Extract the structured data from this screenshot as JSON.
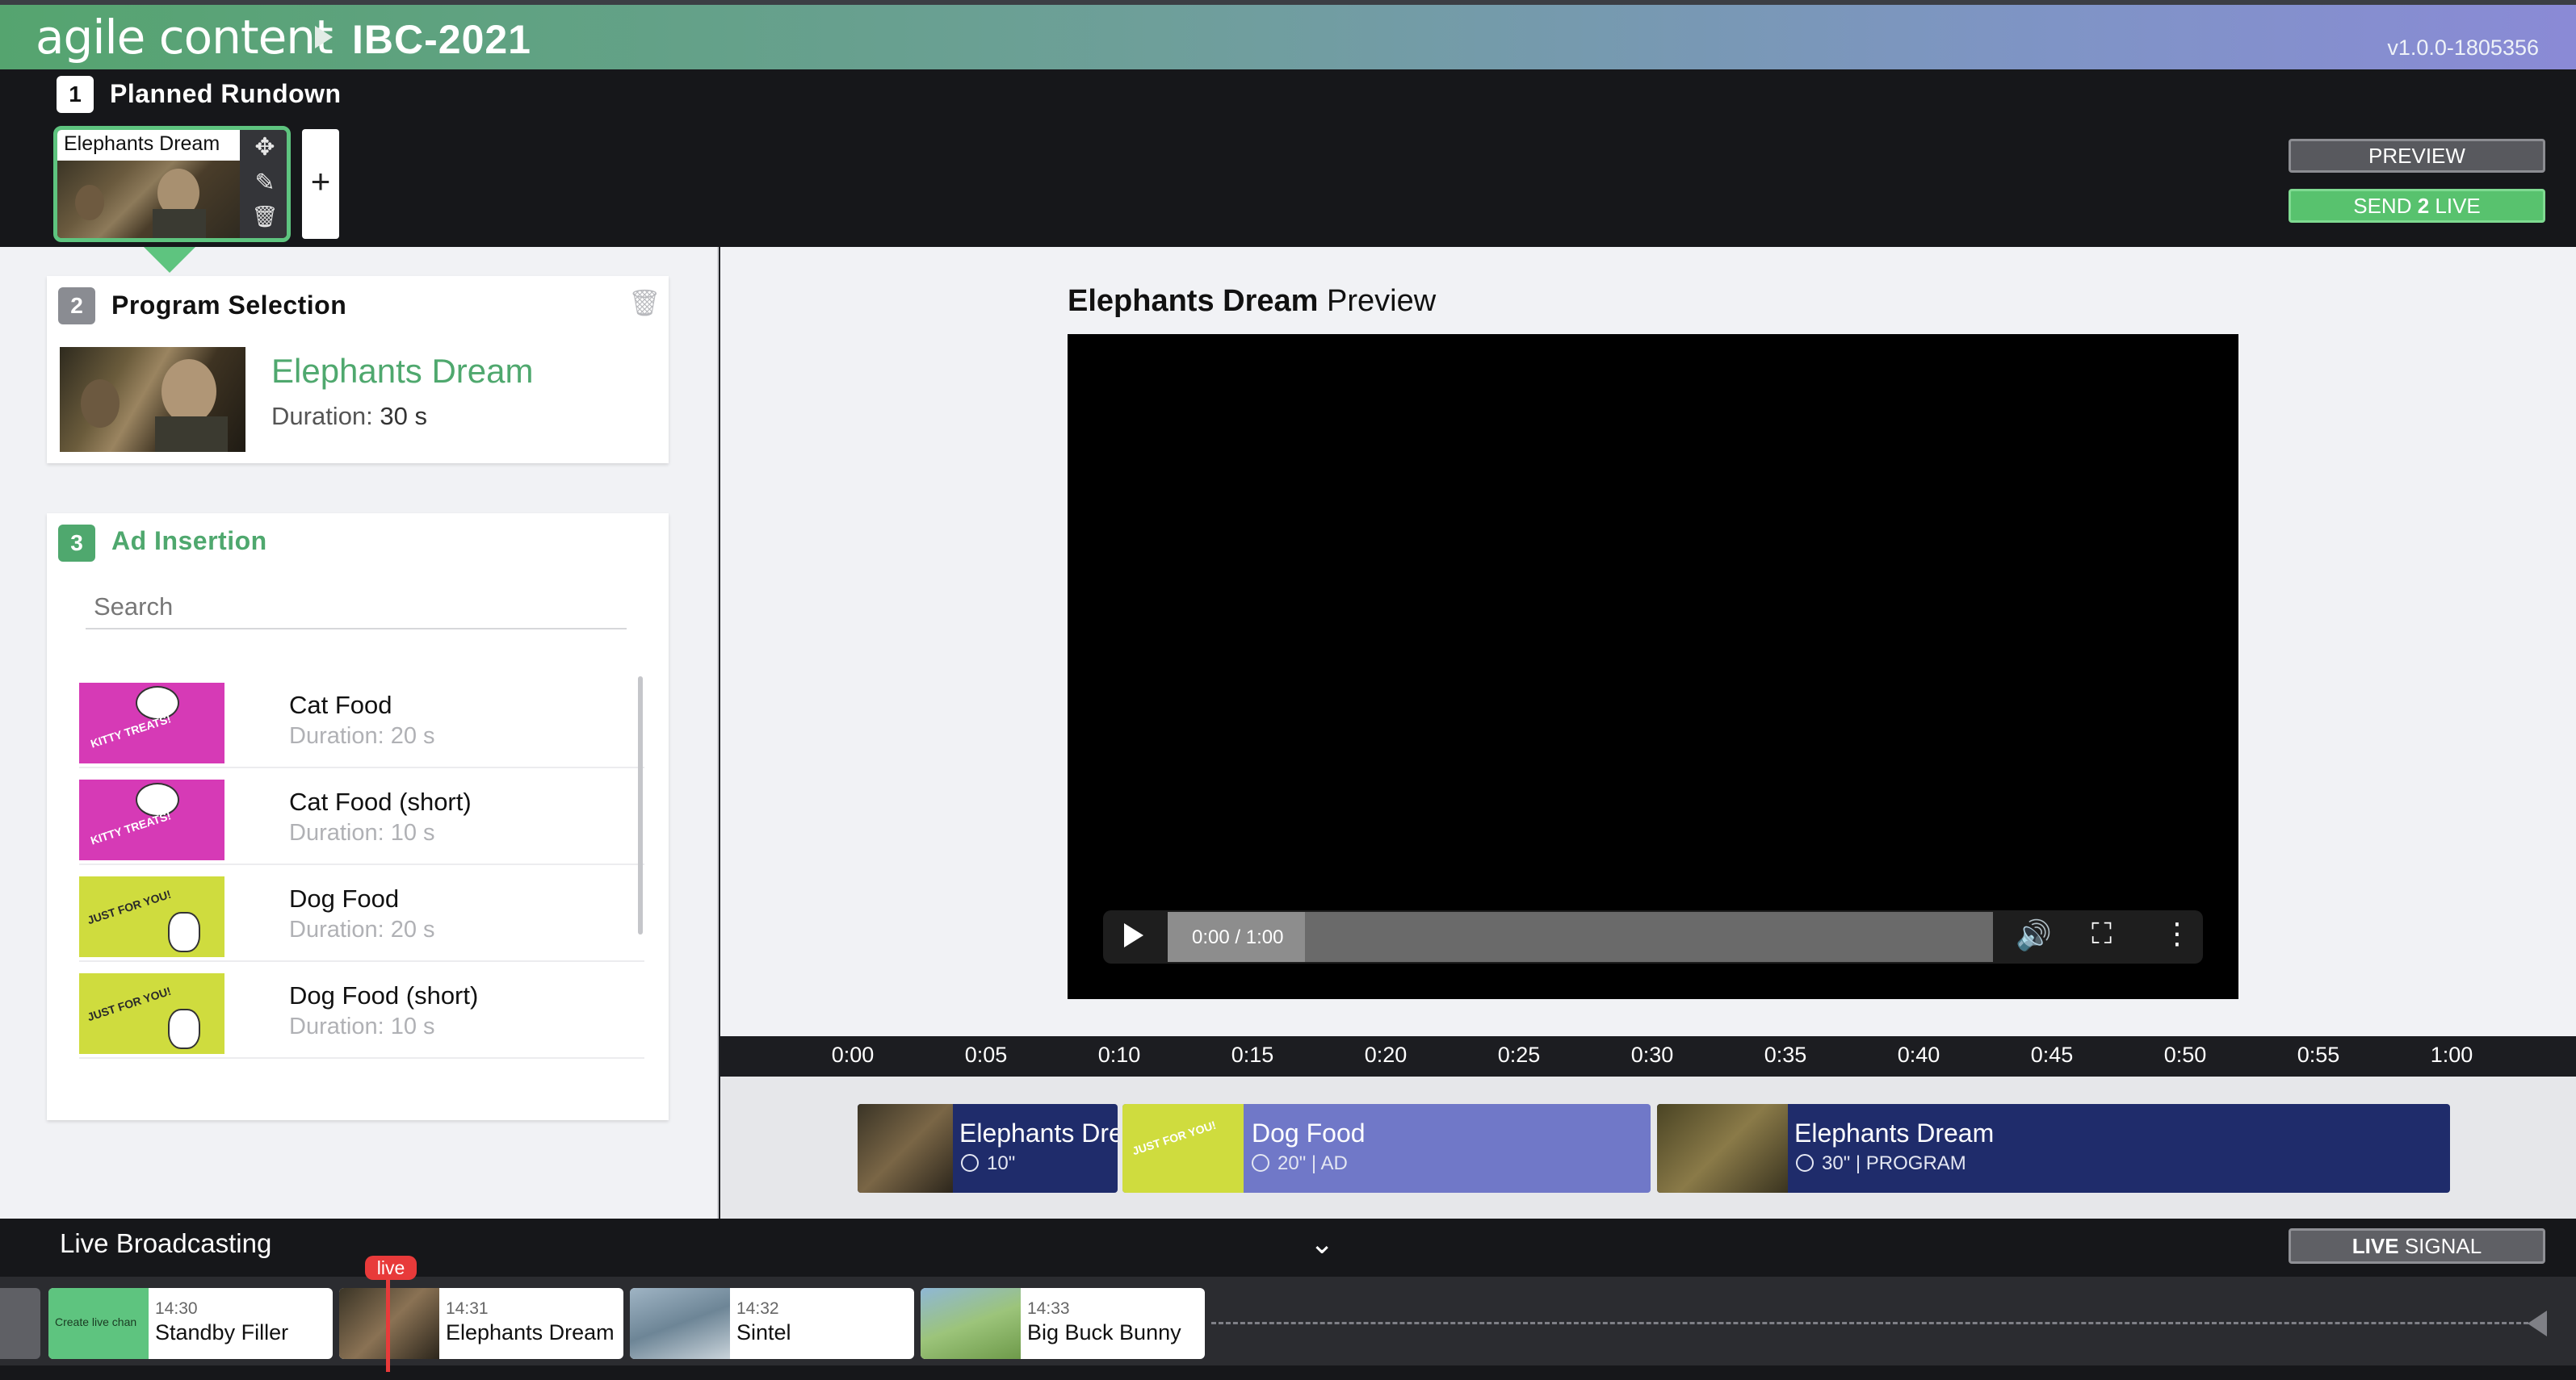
{
  "header": {
    "logo_text": "agile content",
    "event_title": "IBC-2021",
    "version": "v1.0.0-1805356"
  },
  "rundown": {
    "step": "1",
    "title": "Planned Rundown",
    "cards": [
      {
        "label": "Elephants Dream"
      }
    ],
    "add_label": "+",
    "preview_button": "PREVIEW",
    "send_prefix": "SEND ",
    "send_number": "2",
    "send_suffix": " LIVE"
  },
  "program_selection": {
    "step": "2",
    "title": "Program Selection",
    "name": "Elephants Dream",
    "duration_label": "Duration: ",
    "duration_value": "30 s"
  },
  "ad_insertion": {
    "step": "3",
    "title": "Ad Insertion",
    "search_placeholder": "Search",
    "items": [
      {
        "name": "Cat Food",
        "duration": "Duration: 20 s",
        "thumb_text": "KITTY TREATS!"
      },
      {
        "name": "Cat Food (short)",
        "duration": "Duration: 10 s",
        "thumb_text": "KITTY TREATS!"
      },
      {
        "name": "Dog Food",
        "duration": "Duration: 20 s",
        "thumb_text": "JUST FOR YOU!"
      },
      {
        "name": "Dog Food (short)",
        "duration": "Duration: 10 s",
        "thumb_text": "JUST FOR YOU!"
      }
    ]
  },
  "preview": {
    "title_bold": "Elephants Dream",
    "title_rest": " Preview",
    "time": "0:00 / 1:00"
  },
  "timeline": {
    "ticks": [
      "0:00",
      "0:05",
      "0:10",
      "0:15",
      "0:20",
      "0:25",
      "0:30",
      "0:35",
      "0:40",
      "0:45",
      "0:50",
      "0:55",
      "1:00"
    ],
    "segments": [
      {
        "name": "Elephants Dre",
        "meta": "10\"",
        "color": "#1f2c6b"
      },
      {
        "name": "Dog Food",
        "meta": "20\"  |  AD",
        "color": "#7078c8"
      },
      {
        "name": "Elephants Dream",
        "meta": "30\"  |  PROGRAM",
        "color": "#1f2c6b"
      }
    ]
  },
  "live": {
    "title": "Live Broadcasting",
    "live_signal_bold": "LIVE",
    "live_signal_rest": " SIGNAL",
    "badge": "live",
    "items": [
      {
        "time": "14:30",
        "name": "Standby Filler",
        "thumb_text": "Create live chan"
      },
      {
        "time": "14:31",
        "name": "Elephants Dream"
      },
      {
        "time": "14:32",
        "name": "Sintel"
      },
      {
        "time": "14:33",
        "name": "Big Buck Bunny"
      }
    ]
  },
  "colors": {
    "brand_green": "#4fa86e",
    "send_live_green": "#58c26e",
    "program_segment": "#1f2c6b",
    "ad_segment": "#7078c8",
    "live_red": "#e83a3a"
  }
}
